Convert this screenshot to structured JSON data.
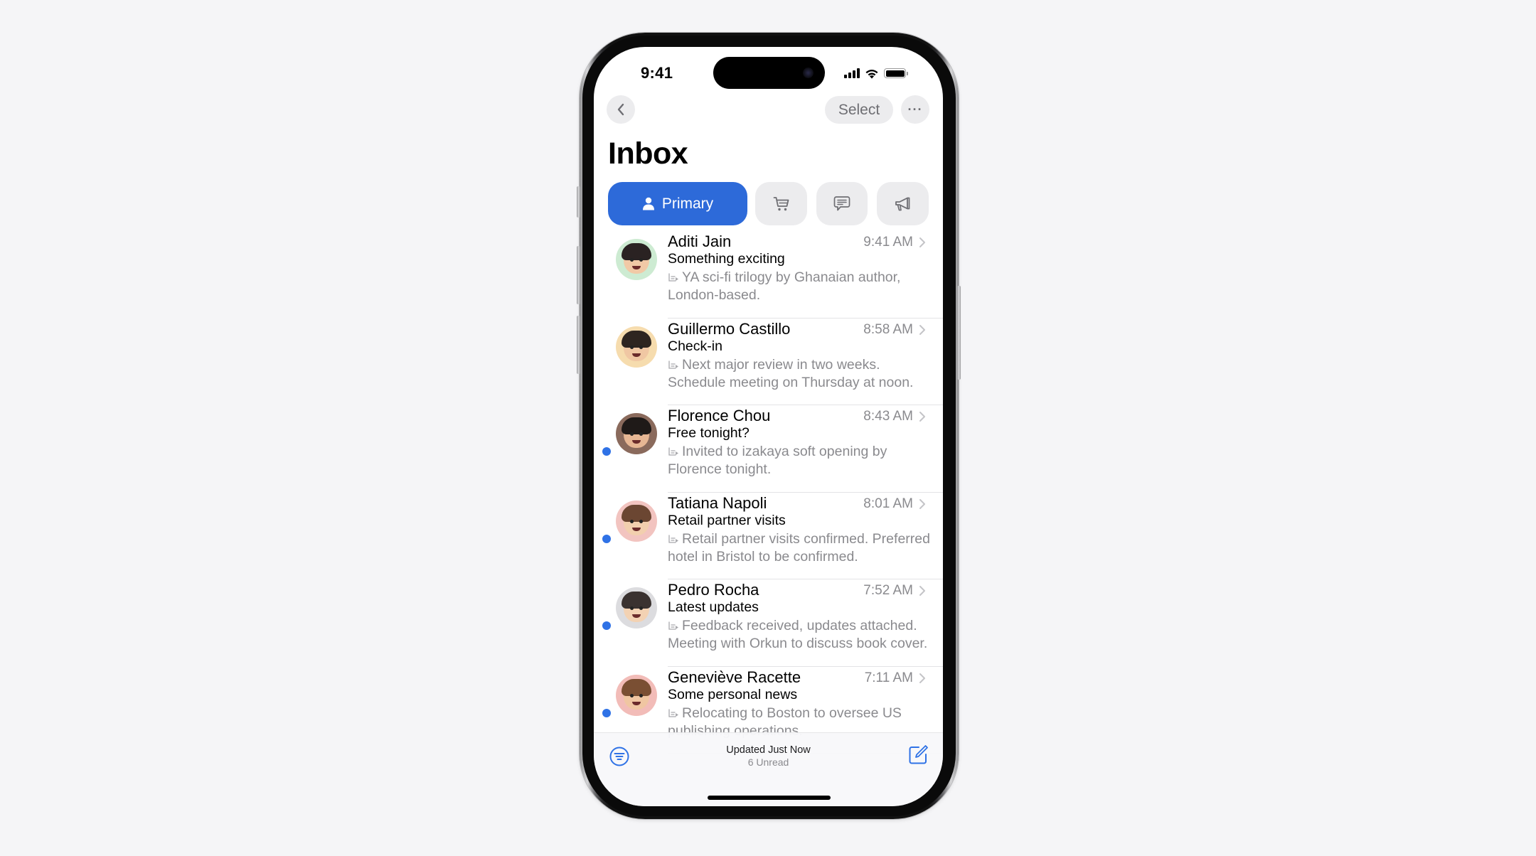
{
  "status_bar": {
    "time": "9:41",
    "icons": [
      "cellular-signal-icon",
      "wifi-icon",
      "battery-icon"
    ]
  },
  "nav": {
    "back_icon": "chevron-left-icon",
    "select_label": "Select",
    "more_label": "···"
  },
  "title": "Inbox",
  "tabs": [
    {
      "id": "primary",
      "label": "Primary",
      "icon": "person-icon",
      "selected": true
    },
    {
      "id": "transactions",
      "label": "",
      "icon": "cart-icon",
      "selected": false
    },
    {
      "id": "updates",
      "label": "",
      "icon": "message-bubble-icon",
      "selected": false
    },
    {
      "id": "promotions",
      "label": "",
      "icon": "megaphone-icon",
      "selected": false
    }
  ],
  "emails": [
    {
      "sender": "Aditi Jain",
      "time": "9:41 AM",
      "subject": "Something exciting",
      "preview": "YA sci-fi trilogy by Ghanaian author, London-based.",
      "unread": false,
      "avatar_bg": "#cdebd2"
    },
    {
      "sender": "Guillermo Castillo",
      "time": "8:58 AM",
      "subject": "Check-in",
      "preview": "Next major review in two weeks. Schedule meeting on Thursday at noon.",
      "unread": false,
      "avatar_bg": "#f6dcae"
    },
    {
      "sender": "Florence Chou",
      "time": "8:43 AM",
      "subject": "Free tonight?",
      "preview": "Invited to izakaya soft opening by Florence tonight.",
      "unread": true,
      "avatar_bg": "#8a6a5c"
    },
    {
      "sender": "Tatiana Napoli",
      "time": "8:01 AM",
      "subject": "Retail partner visits",
      "preview": "Retail partner visits confirmed. Preferred hotel in Bristol to be confirmed.",
      "unread": true,
      "avatar_bg": "#f2c4c0"
    },
    {
      "sender": "Pedro Rocha",
      "time": "7:52 AM",
      "subject": "Latest updates",
      "preview": "Feedback received, updates attached. Meeting with Orkun to discuss book cover.",
      "unread": true,
      "avatar_bg": "#dcdcdf"
    },
    {
      "sender": "Geneviève Racette",
      "time": "7:11 AM",
      "subject": "Some personal news",
      "preview": "Relocating to Boston to oversee US publishing operations.",
      "unread": true,
      "avatar_bg": "#f2bcb8"
    }
  ],
  "bottom_bar": {
    "status": "Updated Just Now",
    "unread": "6 Unread",
    "filter_icon": "filter-icon",
    "compose_icon": "compose-icon"
  },
  "colors": {
    "accent": "#2d6ad9",
    "unread_dot": "#2f72e6",
    "secondary_text": "#8a8a8e",
    "chip_bg": "#ececee"
  }
}
